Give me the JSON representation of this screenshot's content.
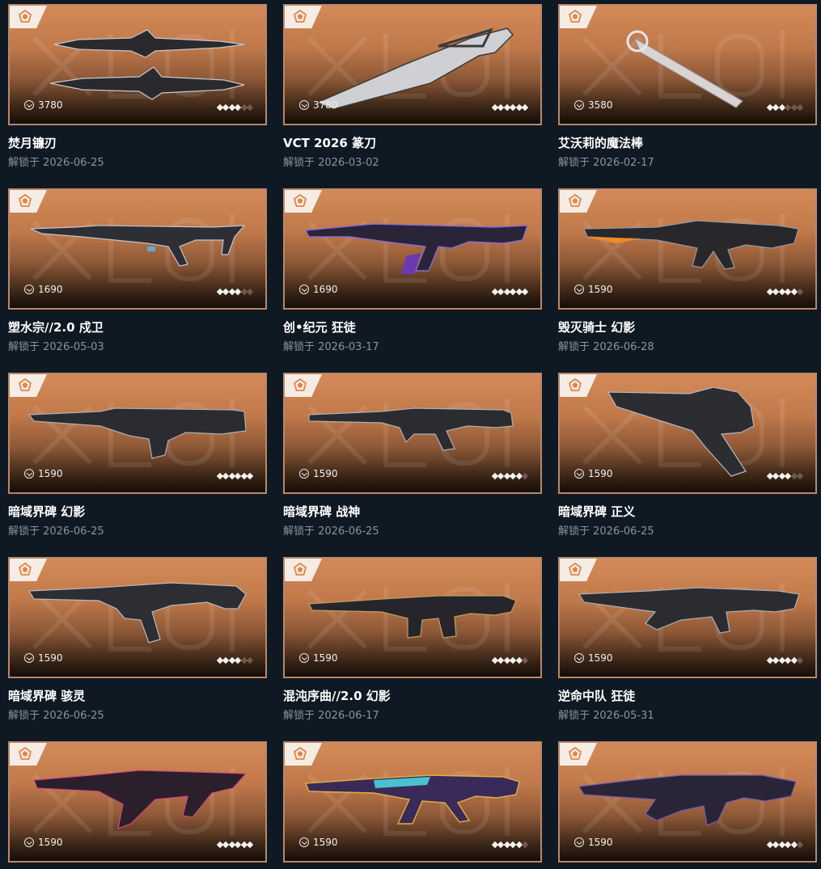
{
  "items": [
    {
      "name": "焚月镰刃",
      "date": "解锁于 2026-06-25",
      "price": "3780",
      "stars": 4
    },
    {
      "name": "VCT 2026 篆刀",
      "date": "解锁于 2026-03-02",
      "price": "3780",
      "stars": 6
    },
    {
      "name": "艾沃莉的魔法棒",
      "date": "解锁于 2026-02-17",
      "price": "3580",
      "stars": 3
    },
    {
      "name": "塑水宗//2.0 戍卫",
      "date": "解锁于 2026-05-03",
      "price": "1690",
      "stars": 4
    },
    {
      "name": "创•纪元 狂徒",
      "date": "解锁于 2026-03-17",
      "price": "1690",
      "stars": 6
    },
    {
      "name": "毁灭骑士 幻影",
      "date": "解锁于 2026-06-28",
      "price": "1590",
      "stars": 5
    },
    {
      "name": "暗域界碑 幻影",
      "date": "解锁于 2026-06-25",
      "price": "1590",
      "stars": 6
    },
    {
      "name": "暗域界碑 战神",
      "date": "解锁于 2026-06-25",
      "price": "1590",
      "stars": 5
    },
    {
      "name": "暗域界碑 正义",
      "date": "解锁于 2026-06-25",
      "price": "1590",
      "stars": 4
    },
    {
      "name": "暗域界碑 骇灵",
      "date": "解锁于 2026-06-25",
      "price": "1590",
      "stars": 4
    },
    {
      "name": "混沌序曲//2.0 幻影",
      "date": "解锁于 2026-06-17",
      "price": "1590",
      "stars": 5
    },
    {
      "name": "逆命中队 狂徒",
      "date": "解锁于 2026-05-31",
      "price": "1590",
      "stars": 5
    },
    {
      "name": "",
      "date": "",
      "price": "1590",
      "stars": 6
    },
    {
      "name": "",
      "date": "",
      "price": "1590",
      "stars": 5
    },
    {
      "name": "",
      "date": "",
      "price": "1590",
      "stars": 5
    }
  ],
  "rating_max": 6,
  "icons": {
    "tier": "pentagon-tier-icon",
    "currency": "vp-currency-icon",
    "rating": "diamond-rating-icon"
  },
  "colors": {
    "page_bg": "#0f1923",
    "card_border": "#b9876a",
    "card_top": "#d48a58",
    "card_bottom": "#140d08",
    "badge": "#f5ece4",
    "tier_icon": "#e0854a"
  }
}
